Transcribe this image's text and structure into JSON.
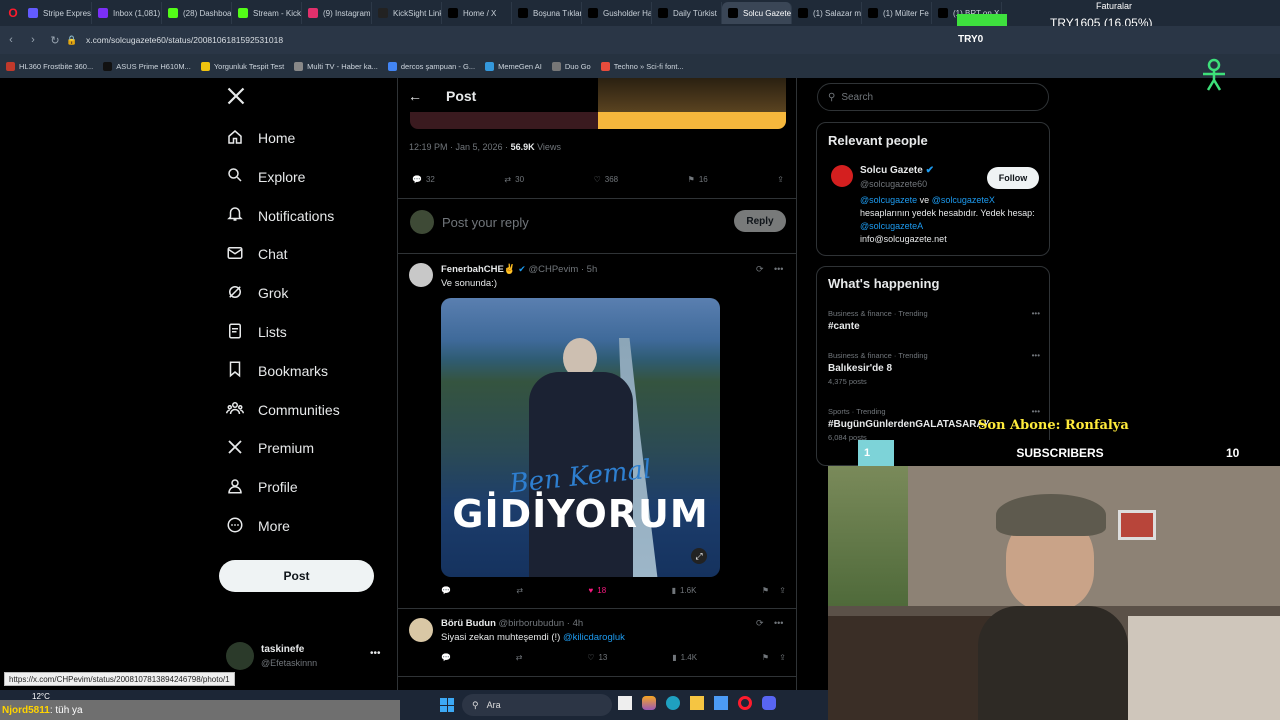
{
  "browser": {
    "tabs": [
      {
        "label": "Stripe Express",
        "color": "#635bff"
      },
      {
        "label": "Inbox (1,081)",
        "color": "#7b2ff7"
      },
      {
        "label": "(28) Dashboar",
        "color": "#53fc18"
      },
      {
        "label": "Stream - Kick",
        "color": "#53fc18"
      },
      {
        "label": "(9) Instagram",
        "color": "#e1306c"
      },
      {
        "label": "KickSight Link",
        "color": "#222"
      },
      {
        "label": "Home / X",
        "color": "#000"
      },
      {
        "label": "Boşuna Tıklam",
        "color": "#000"
      },
      {
        "label": "Gusholder Ha",
        "color": "#000"
      },
      {
        "label": "Daily Türkist",
        "color": "#000"
      },
      {
        "label": "Solcu Gazete on X: \"Ke",
        "color": "#000"
      },
      {
        "label": "(1) Salazar ma",
        "color": "#000"
      },
      {
        "label": "(1) Mülter Fe",
        "color": "#000"
      },
      {
        "label": "(1) BRT on X",
        "color": "#000"
      }
    ],
    "active_tab_index": 10,
    "url": "x.com/solcugazete60/status/2008106181592531018",
    "bookmarks": [
      {
        "label": "HL360 Frostbite 360...",
        "color": "#c0392b"
      },
      {
        "label": "ASUS Prime H610M...",
        "color": "#111"
      },
      {
        "label": "Yorgunluk Tespit Test",
        "color": "#f1c40f"
      },
      {
        "label": "Multi TV - Haber ka...",
        "color": "#888"
      },
      {
        "label": "dercos şampuan - G...",
        "color": "#4285f4"
      },
      {
        "label": "MemeGen AI",
        "color": "#3498db"
      },
      {
        "label": "Duo Go",
        "color": "#777"
      },
      {
        "label": "Techno » Sci-fi font...",
        "color": "#e74c3c"
      }
    ],
    "status_url": "https://x.com/CHPevim/status/2008107813894246798/photo/1"
  },
  "overlay": {
    "try_text": "TRY1605 (16.05%)",
    "try_label": "TRY0",
    "faturalar": "Faturalar",
    "son_abone": "Son Abone: Ronfalya",
    "subscribers_label": "SUBSCRIBERS",
    "subscribers_left": "1",
    "subscribers_right": "10",
    "chat_user": "Njord5811",
    "chat_msg": ": tüh ya",
    "weather": "12°C"
  },
  "nav": {
    "items": [
      {
        "label": "Home",
        "icon": "home-icon"
      },
      {
        "label": "Explore",
        "icon": "search-icon"
      },
      {
        "label": "Notifications",
        "icon": "bell-icon"
      },
      {
        "label": "Chat",
        "icon": "mail-icon"
      },
      {
        "label": "Grok",
        "icon": "grok-icon"
      },
      {
        "label": "Lists",
        "icon": "lists-icon"
      },
      {
        "label": "Bookmarks",
        "icon": "bookmark-icon"
      },
      {
        "label": "Communities",
        "icon": "communities-icon"
      },
      {
        "label": "Premium",
        "icon": "x-logo-icon"
      },
      {
        "label": "Profile",
        "icon": "profile-icon"
      },
      {
        "label": "More",
        "icon": "more-icon"
      }
    ],
    "post_label": "Post",
    "account": {
      "name": "taskinefe",
      "handle": "@Efetaskinnn"
    }
  },
  "main": {
    "header_title": "Post",
    "post_meta": {
      "time": "12:19 PM · Jan 5, 2026 · ",
      "views": "56.9K",
      "views_label": " Views"
    },
    "post_actions": {
      "replies": "32",
      "reposts": "30",
      "likes": "368",
      "bookmarks": "16"
    },
    "reply_placeholder": "Post your reply",
    "reply_button": "Reply",
    "reply1": {
      "name": "FenerbahCHE✌️",
      "handle": "@CHPevim · 5h",
      "text": "Ve sonunda:)",
      "image_text_script": "Ben Kemal",
      "image_text_big": "GİDİYORUM",
      "likes": "18",
      "views": "1.6K"
    },
    "reply2": {
      "name": "Börü Budun",
      "handle": "@birborubudun · 4h",
      "text": "Siyasi zekan muhteşemdi (!) ",
      "mention": "@kilicdarogluk",
      "likes": "13",
      "views": "1.4K"
    }
  },
  "right": {
    "search_placeholder": "Search",
    "relevant_title": "Relevant people",
    "person": {
      "name": "Solcu Gazete",
      "handle": "@solcugazete60",
      "follow": "Follow",
      "bio_m1": "@solcugazete",
      "bio_and": " ve ",
      "bio_m2": "@solcugazeteX",
      "bio_rest": " hesaplarının yedek hesabıdır. Yedek hesap: ",
      "bio_m3": "@solcugazeteA",
      "bio_email": "info@solcugazete.net"
    },
    "happening_title": "What's happening",
    "trends": [
      {
        "meta": "Business & finance · Trending",
        "name": "#cante",
        "posts": ""
      },
      {
        "meta": "Business & finance · Trending",
        "name": "Balıkesir'de 8",
        "posts": "4,375 posts"
      },
      {
        "meta": "Sports · Trending",
        "name": "#BugünGünlerdenGALATASARAY",
        "posts": "6,084 posts"
      }
    ]
  },
  "taskbar": {
    "search_label": "Ara"
  }
}
